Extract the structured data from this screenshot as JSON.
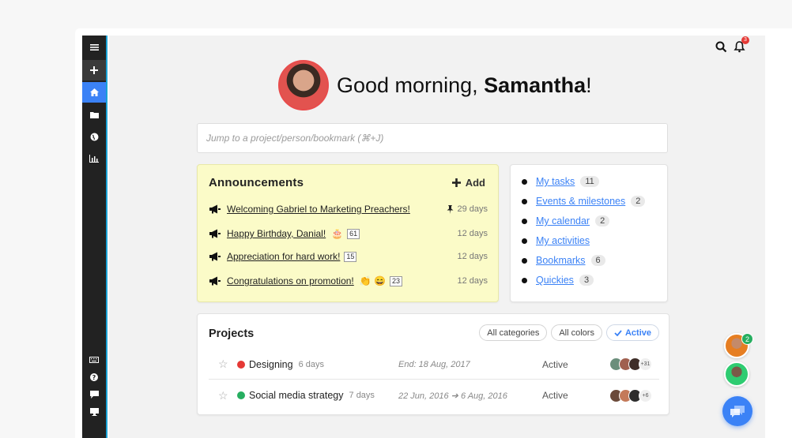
{
  "header": {
    "greeting_prefix": "Good morning, ",
    "user_name": "Samantha",
    "greeting_suffix": "!",
    "notification_count": "3"
  },
  "search": {
    "placeholder": "Jump to a project/person/bookmark (⌘+J)"
  },
  "announcements": {
    "title": "Announcements",
    "add_label": "Add",
    "items": [
      {
        "text": "Welcoming Gabriel to Marketing Preachers!",
        "emoji": "",
        "count": "",
        "days": "29 days",
        "pinned": true
      },
      {
        "text": "Happy Birthday, Danial!",
        "emoji": "🎂",
        "count": "61",
        "days": "12 days",
        "pinned": false
      },
      {
        "text": "Appreciation for hard work!",
        "emoji": "",
        "count": "15",
        "days": "12 days",
        "pinned": false
      },
      {
        "text": "Congratulations on promotion!",
        "emoji": "👏 😄",
        "count": "23",
        "days": "12 days",
        "pinned": false
      }
    ]
  },
  "quick_links": [
    {
      "label": "My tasks",
      "count": "11"
    },
    {
      "label": "Events & milestones",
      "count": "2"
    },
    {
      "label": "My calendar",
      "count": "2"
    },
    {
      "label": "My activities",
      "count": ""
    },
    {
      "label": "Bookmarks",
      "count": "6"
    },
    {
      "label": "Quickies",
      "count": "3"
    }
  ],
  "projects": {
    "title": "Projects",
    "filters": [
      {
        "label": "All categories",
        "active": false
      },
      {
        "label": "All colors",
        "active": false
      },
      {
        "label": "Active",
        "active": true
      }
    ],
    "rows": [
      {
        "name": "Designing",
        "days": "6 days",
        "dates": "End: 18 Aug, 2017",
        "status": "Active",
        "dot_color": "#e53935",
        "more": "+31"
      },
      {
        "name": "Social media strategy",
        "days": "7 days",
        "dates": "22 Jun, 2016 ➔ 6 Aug, 2016",
        "status": "Active",
        "dot_color": "#27ae60",
        "more": "+6"
      }
    ]
  },
  "chat": {
    "unread_count": "2"
  },
  "sidebar": {
    "icons": [
      "menu-icon",
      "plus-icon",
      "home-icon",
      "folder-icon",
      "globe-icon",
      "chart-icon",
      "keyboard-icon",
      "help-icon",
      "chat-icon",
      "monitor-icon"
    ]
  },
  "colors": {
    "accent": "#3b82f6",
    "sidebar": "#222222",
    "announcement_bg": "#fbfbc8"
  }
}
